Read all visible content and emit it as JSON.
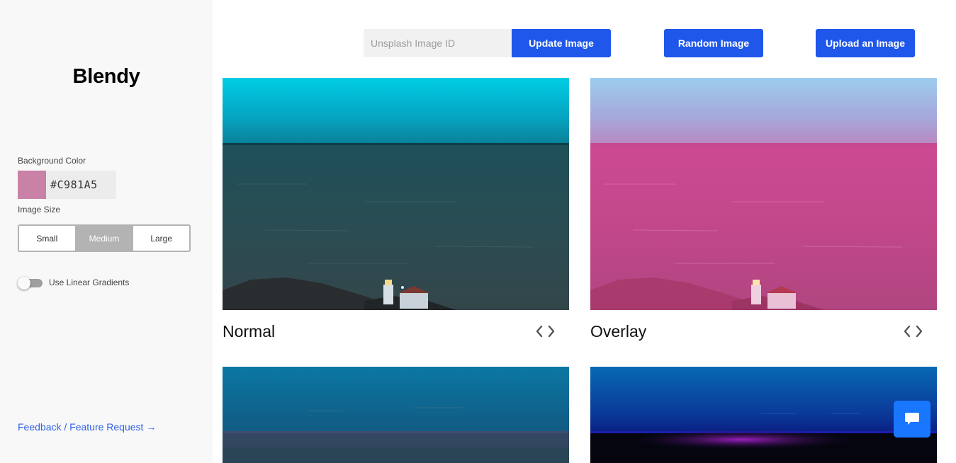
{
  "sidebar": {
    "brand": "Blendy",
    "background_color_label": "Background Color",
    "background_color_value": "#C981A5",
    "background_color_swatch": "#C981A5",
    "image_size_label": "Image Size",
    "image_size_options": [
      "Small",
      "Medium",
      "Large"
    ],
    "image_size_selected": "Medium",
    "linear_gradients_label": "Use Linear Gradients",
    "linear_gradients_on": false,
    "feedback_link": "Feedback / Feature Request →"
  },
  "topbar": {
    "unsplash_placeholder": "Unsplash Image ID",
    "unsplash_value": "",
    "update_button": "Update Image",
    "random_button": "Random Image",
    "upload_button": "Upload an Image"
  },
  "cards": [
    {
      "title": "Normal"
    },
    {
      "title": "Overlay"
    },
    {
      "title": ""
    },
    {
      "title": ""
    }
  ],
  "icons": {
    "code": "code-brackets-icon",
    "chat": "chat-bubble-icon"
  },
  "colors": {
    "accent": "#1F57EB",
    "chat": "#1977FF",
    "link": "#2F62E8",
    "segment_active": "#B3B3B3"
  }
}
